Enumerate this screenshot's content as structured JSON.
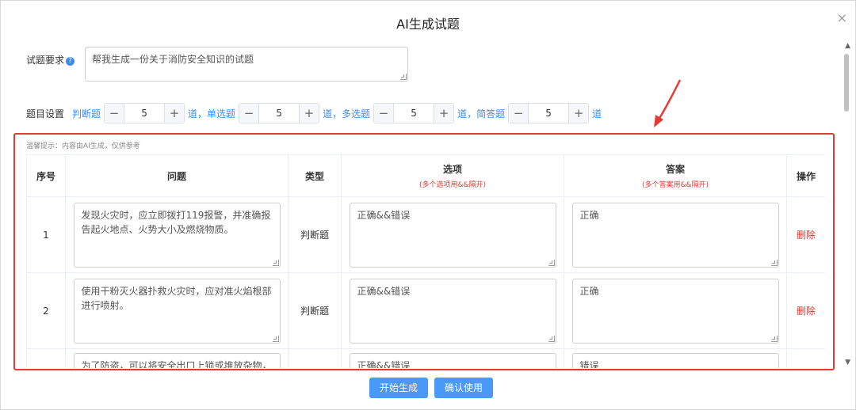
{
  "dialog": {
    "title": "AI生成试题",
    "close_glyph": "×"
  },
  "requirement": {
    "label": "试题要求",
    "help_glyph": "?",
    "value": "帮我生成一份关于消防安全知识的试题"
  },
  "settings": {
    "label": "题目设置",
    "unit": "道，",
    "last_unit": "道",
    "types": [
      {
        "name": "判断题",
        "count": "5"
      },
      {
        "name": "单选题",
        "count": "5"
      },
      {
        "name": "多选题",
        "count": "5"
      },
      {
        "name": "简答题",
        "count": "5"
      }
    ],
    "minus": "−",
    "plus": "+"
  },
  "hint": "温馨提示：内容由AI生成，仅供参考",
  "table": {
    "headers": {
      "index": "序号",
      "question": "问题",
      "type": "类型",
      "options": "选项",
      "options_note": "(多个选项用&&隔开)",
      "answer": "答案",
      "answer_note": "(多个答案用&&隔开)",
      "action": "操作"
    },
    "rows": [
      {
        "index": "1",
        "question": "发现火灾时，应立即拨打119报警，并准确报告起火地点、火势大小及燃烧物质。",
        "type": "判断题",
        "options": "正确&&错误",
        "answer": "正确",
        "action": "删除"
      },
      {
        "index": "2",
        "question": "使用干粉灭火器扑救火灾时，应对准火焰根部进行喷射。",
        "type": "判断题",
        "options": "正确&&错误",
        "answer": "正确",
        "action": "删除"
      },
      {
        "index": "",
        "question": "为了防盗，可以将安全出口上锁或堆放杂物，只",
        "type": "",
        "options": "正确&&错误",
        "answer": "错误",
        "action": ""
      }
    ]
  },
  "footer": {
    "generate": "开始生成",
    "confirm": "确认使用"
  },
  "colors": {
    "accent": "#3d8bf2",
    "button": "#4a98f7",
    "danger": "#e53935"
  }
}
